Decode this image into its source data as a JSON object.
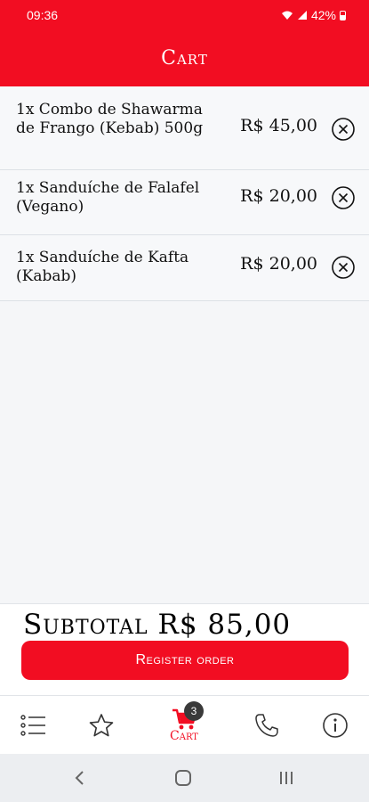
{
  "status": {
    "time": "09:36",
    "battery": "42%"
  },
  "header": {
    "title": "Cart"
  },
  "items": [
    {
      "name": "1x Combo de Shawarma de Frango (Kebab) 500g",
      "price": "R$ 45,00"
    },
    {
      "name": "1x Sanduíche de Falafel (Vegano)",
      "price": "R$ 20,00"
    },
    {
      "name": "1x Sanduíche de Kafta (Kabab)",
      "price": "R$ 20,00"
    }
  ],
  "summary": {
    "subtotal": "Subtotal R$ 85,00",
    "register_label": "Register order"
  },
  "tabbar": {
    "cart_label": "Cart",
    "cart_count": "3"
  },
  "colors": {
    "brand": "#f20d22"
  },
  "icons": {
    "menu": "list-icon",
    "favorites": "star-icon",
    "cart": "cart-icon",
    "phone": "phone-icon",
    "info": "info-icon",
    "remove": "close-circle-icon"
  }
}
